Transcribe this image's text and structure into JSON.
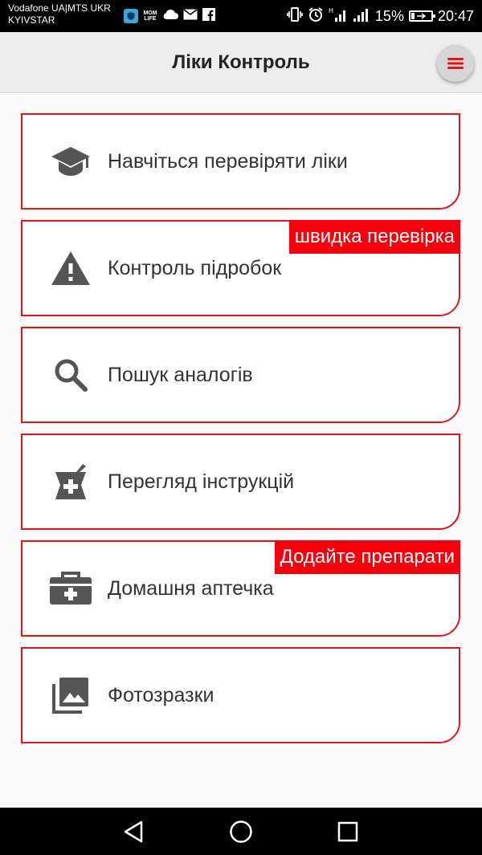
{
  "status_bar": {
    "carrier_line1": "Vodafone UA|MTS UKR",
    "carrier_line2": "KYIVSTAR",
    "battery_percent": "15%",
    "battery_level": 0.15,
    "time": "20:47",
    "notification_icons": [
      "shield-icon",
      "momlife-icon",
      "cloud-icon",
      "mail-icon",
      "facebook-icon"
    ],
    "system_icons": [
      "vibrate-icon",
      "alarm-icon",
      "signal-h-icon",
      "signal-icon",
      "battery-charging-icon"
    ]
  },
  "app_bar": {
    "title": "Ліки Контроль",
    "menu_icon": "hamburger-menu-icon"
  },
  "colors": {
    "accent": "#e0161c",
    "badge": "#f5000d",
    "icon_gray": "#555555"
  },
  "menu": [
    {
      "label": "Навчіться перевіряти ліки",
      "icon": "graduation-cap-icon",
      "badge": ""
    },
    {
      "label": "Контроль підробок",
      "icon": "warning-icon",
      "badge": "швидка перевірка"
    },
    {
      "label": "Пошук аналогів",
      "icon": "search-icon",
      "badge": ""
    },
    {
      "label": "Перегляд інструкцій",
      "icon": "pharmacy-mortar-icon",
      "badge": ""
    },
    {
      "label": "Домашня аптечка",
      "icon": "medical-kit-icon",
      "badge": "Додайте препарати"
    },
    {
      "label": "Фотозразки",
      "icon": "photo-library-icon",
      "badge": ""
    }
  ],
  "nav_bar": {
    "icons": [
      "back-icon",
      "home-icon",
      "recents-icon"
    ]
  }
}
